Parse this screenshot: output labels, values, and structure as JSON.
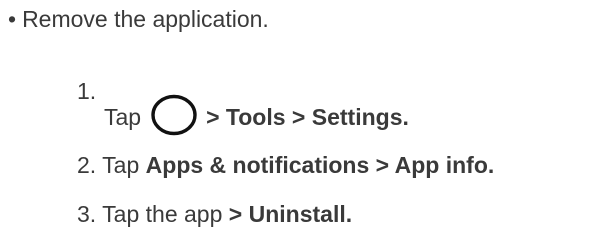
{
  "bullet": {
    "marker": "•",
    "text": "Remove the application."
  },
  "steps": [
    {
      "number": "1.",
      "prefix": "Tap",
      "icon": "home-circle-icon",
      "bold": "> Tools > Settings."
    },
    {
      "number": "2.",
      "prefix": "Tap",
      "bold": "Apps & notifications > App info."
    },
    {
      "number": "3.",
      "prefix": "Tap the app",
      "bold": "> Uninstall."
    }
  ]
}
